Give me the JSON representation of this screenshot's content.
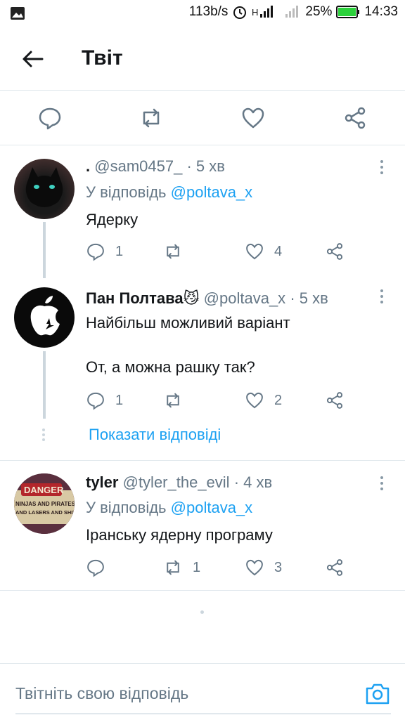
{
  "status_bar": {
    "network_speed": "113b/s",
    "battery": "25%",
    "time": "14:33"
  },
  "header": {
    "title": "Твіт"
  },
  "tweets": [
    {
      "name": ".",
      "handle": "@sam0457_",
      "time": "· 5 хв",
      "reply_prefix": "У відповідь",
      "reply_to": "@poltava_x",
      "text": "Ядерку",
      "replies": "1",
      "retweets": "",
      "likes": "4"
    },
    {
      "name": "Пан Полтава😼",
      "handle": "@poltava_x",
      "time": "· 5 хв",
      "text_line1": "Найбільш можливий варіант",
      "text_line2": "От, а можна рашку так?",
      "replies": "1",
      "retweets": "",
      "likes": "2"
    },
    {
      "name": "tyler",
      "handle": "@tyler_the_evil",
      "time": "· 4 хв",
      "reply_prefix": "У відповідь",
      "reply_to": "@poltava_x",
      "text": "Іранську ядерну програму",
      "replies": "",
      "retweets": "1",
      "likes": "3",
      "avatar_sign_lines": [
        "DANGER",
        "NINJAS AND PIRATES",
        "AND LASERS AND SHIT"
      ]
    }
  ],
  "show_replies": "Показати відповіді",
  "composer": {
    "placeholder": "Твітніть свою відповідь"
  },
  "colors": {
    "accent": "#1da1f2",
    "muted": "#657786",
    "divider": "#e1e8ed"
  }
}
